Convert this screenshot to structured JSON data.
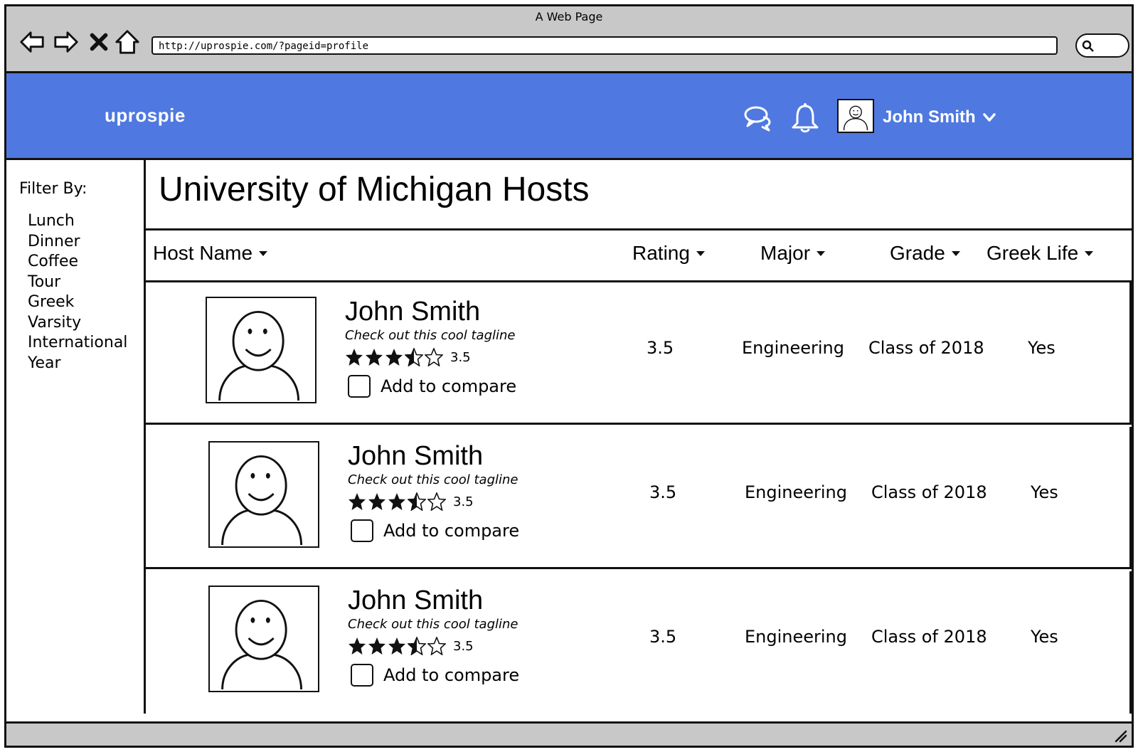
{
  "browser": {
    "window_title": "A Web Page",
    "url": "http://uprospie.com/?pageid=profile",
    "icons": [
      "back-arrow-icon",
      "forward-arrow-icon",
      "close-icon",
      "home-icon",
      "search-icon"
    ]
  },
  "header": {
    "logo": "uprospie",
    "user_name": "John Smith",
    "icons": [
      "chat-icon",
      "bell-icon",
      "avatar",
      "chevron-down-icon"
    ],
    "accent_color": "#4f79e0"
  },
  "sidebar": {
    "filter_label": "Filter By:",
    "filters": [
      "Lunch",
      "Dinner",
      "Coffee",
      "Tour",
      "Greek",
      "Varsity",
      "International",
      "Year"
    ]
  },
  "main": {
    "title": "University of Michigan Hosts",
    "columns": [
      "Host Name",
      "Rating",
      "Major",
      "Grade",
      "Greek Life"
    ],
    "rows": [
      {
        "name": "John Smith",
        "tagline": "Check out this cool tagline",
        "star_rating": 3.5,
        "star_rating_label": "3.5",
        "compare_label": "Add to compare",
        "rating": "3.5",
        "major": "Engineering",
        "grade": "Class of 2018",
        "greek_life": "Yes"
      },
      {
        "name": "John Smith",
        "tagline": "Check out this cool tagline",
        "star_rating": 3.5,
        "star_rating_label": "3.5",
        "compare_label": "Add to compare",
        "rating": "3.5",
        "major": "Engineering",
        "grade": "Class of 2018",
        "greek_life": "Yes"
      },
      {
        "name": "John Smith",
        "tagline": "Check out this cool tagline",
        "star_rating": 3.5,
        "star_rating_label": "3.5",
        "compare_label": "Add to compare",
        "rating": "3.5",
        "major": "Engineering",
        "grade": "Class of 2018",
        "greek_life": "Yes"
      }
    ]
  }
}
